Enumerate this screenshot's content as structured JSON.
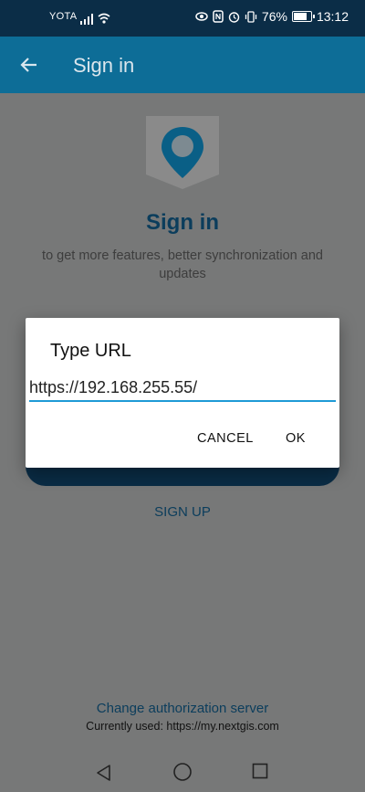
{
  "status_bar": {
    "carrier": "YOTA",
    "battery": "76%",
    "time": "13:12",
    "icons": [
      "signal-icon",
      "wifi-icon",
      "eye-icon",
      "nfc-icon",
      "alarm-icon",
      "vibrate-icon",
      "battery-icon"
    ]
  },
  "app_bar": {
    "title": "Sign in",
    "back_icon": "arrow-left-icon"
  },
  "page": {
    "title": "Sign in",
    "subtitle": "to get more features, better synchronization and updates",
    "signup": "SIGN UP",
    "change_auth": "Change authorization server",
    "currently_used": "Currently used: https://my.nextgis.com"
  },
  "dialog": {
    "title": "Type URL",
    "url_value": "https://192.168.255.55/",
    "cancel": "CANCEL",
    "ok": "OK"
  },
  "colors": {
    "status_bar": "#0b2d47",
    "app_bar": "#0d6d97",
    "accent": "#1e9ad6",
    "brand_dark": "#0b3d5c"
  }
}
